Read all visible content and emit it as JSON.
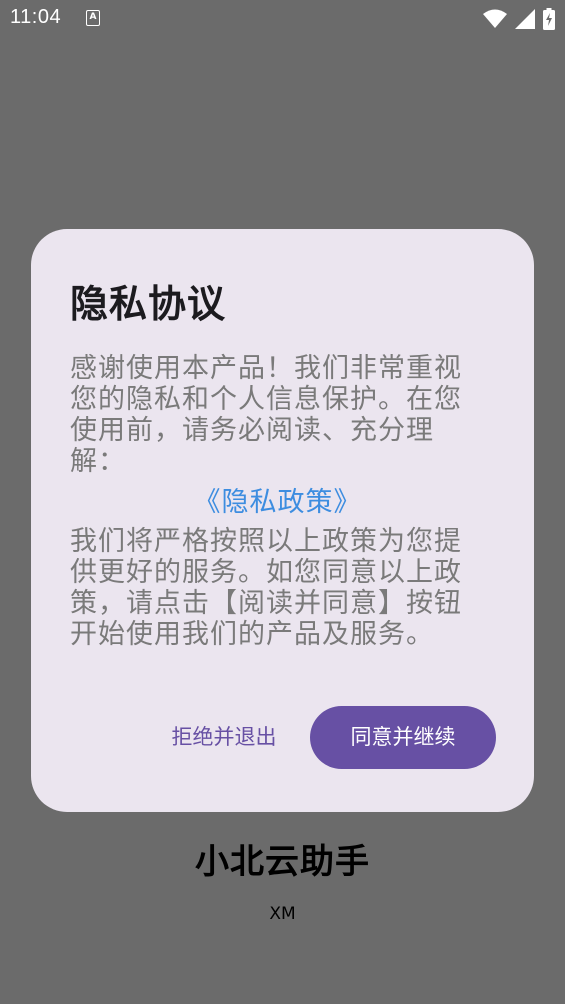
{
  "status_bar": {
    "time": "11:04",
    "notification_letter": "A"
  },
  "dialog": {
    "title": "隐私协议",
    "body_intro": "感谢使用本产品！我们非常重视您的隐私和个人信息保护。在您使用前，请务必阅读、充分理解：",
    "policy_link": "《隐私政策》",
    "body_outro": "我们将严格按照以上政策为您提供更好的服务。如您同意以上政策，请点击【阅读并同意】按钮开始使用我们的产品及服务。",
    "reject_label": "拒绝并退出",
    "agree_label": "同意并继续"
  },
  "app": {
    "name": "小北云助手",
    "author": "XM"
  },
  "colors": {
    "accent": "#6750a4",
    "link": "#3d8de0",
    "dialog_bg": "#ebe5ef",
    "scrim": "#6b6b6b"
  }
}
